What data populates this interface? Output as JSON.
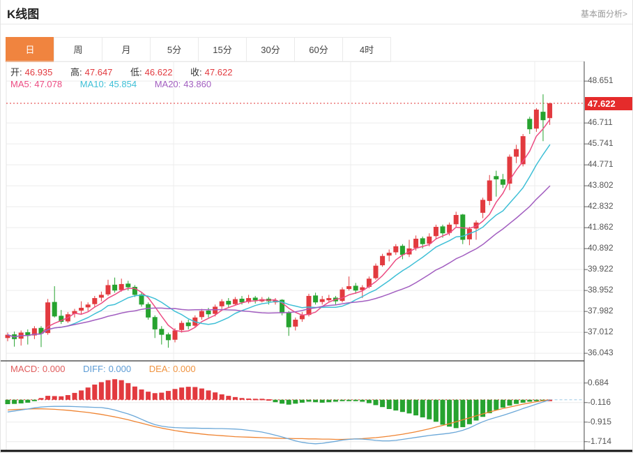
{
  "header": {
    "title": "K线图",
    "link": "基本面分析>"
  },
  "tabs": {
    "active_index": 0,
    "items": [
      "日",
      "周",
      "月",
      "5分",
      "15分",
      "30分",
      "60分",
      "4时"
    ]
  },
  "quote": {
    "open_label": "开:",
    "open": "46.935",
    "high_label": "高:",
    "high": "47.647",
    "low_label": "低:",
    "low": "46.622",
    "close_label": "收:",
    "close": "47.622"
  },
  "ma": {
    "ma5_label": "MA5:",
    "ma5": "47.078",
    "ma10_label": "MA10:",
    "ma10": "45.854",
    "ma20_label": "MA20:",
    "ma20": "43.860"
  },
  "macd_header": {
    "macd_label": "MACD:",
    "macd": "0.000",
    "diff_label": "DIFF:",
    "diff": "0.000",
    "dea_label": "DEA:",
    "dea": "0.000"
  },
  "price_tag": "47.622",
  "colors": {
    "up": "#e23a3f",
    "down": "#26a32f",
    "ma5": "#ec4b82",
    "ma10": "#3ebfd6",
    "ma20": "#a25ec0",
    "diff_line": "#6aa7d8",
    "dea_line": "#ef8432",
    "tab_active": "#f0843f",
    "tag_bg": "#e52b2b",
    "grid": "#ececec",
    "axis": "#555",
    "dotted_price": "#e03030"
  },
  "chart_data": {
    "type": "candlestick+macd",
    "title": "K线图",
    "legend": [
      "MA5",
      "MA10",
      "MA20",
      "MACD",
      "DIFF",
      "DEA"
    ],
    "price_axis_ticks": [
      "48.651",
      "46.711",
      "45.741",
      "44.771",
      "43.802",
      "42.832",
      "41.862",
      "40.892",
      "39.922",
      "38.952",
      "37.982",
      "37.012",
      "36.043"
    ],
    "macd_axis_ticks": [
      "0.684",
      "-0.116",
      "-0.915",
      "-1.714"
    ],
    "current_price": 47.622,
    "ma_periods": [
      5,
      10,
      20
    ],
    "ma_values_shown": {
      "ma5": 47.078,
      "ma10": 45.854,
      "ma20": 43.86
    },
    "candles": [
      [
        36.75,
        37.0,
        36.6,
        36.9
      ],
      [
        36.92,
        37.05,
        36.35,
        36.7
      ],
      [
        36.72,
        37.1,
        36.4,
        37.0
      ],
      [
        37.02,
        37.15,
        36.45,
        36.85
      ],
      [
        36.87,
        37.3,
        36.7,
        37.2
      ],
      [
        37.22,
        37.3,
        36.33,
        36.95
      ],
      [
        36.98,
        38.56,
        36.9,
        38.4
      ],
      [
        38.42,
        39.15,
        37.7,
        37.75
      ],
      [
        37.78,
        38.05,
        37.4,
        37.5
      ],
      [
        37.52,
        37.95,
        37.45,
        37.85
      ],
      [
        37.87,
        38.1,
        37.7,
        38.0
      ],
      [
        38.02,
        38.45,
        37.85,
        38.15
      ],
      [
        38.17,
        38.4,
        38.0,
        38.3
      ],
      [
        38.32,
        38.7,
        38.2,
        38.6
      ],
      [
        38.62,
        38.9,
        38.45,
        38.75
      ],
      [
        38.77,
        39.45,
        38.7,
        39.2
      ],
      [
        39.22,
        39.55,
        38.85,
        38.95
      ],
      [
        38.97,
        39.5,
        38.9,
        39.25
      ],
      [
        39.27,
        39.4,
        38.95,
        39.1
      ],
      [
        39.12,
        39.2,
        38.65,
        38.75
      ],
      [
        38.77,
        38.85,
        38.2,
        38.3
      ],
      [
        38.32,
        38.4,
        37.6,
        37.7
      ],
      [
        37.72,
        37.8,
        36.75,
        37.15
      ],
      [
        37.17,
        37.3,
        36.45,
        36.9
      ],
      [
        36.92,
        37.0,
        36.3,
        36.65
      ],
      [
        36.67,
        37.2,
        36.55,
        37.1
      ],
      [
        37.12,
        37.55,
        37.0,
        37.45
      ],
      [
        37.47,
        37.6,
        37.15,
        37.3
      ],
      [
        37.32,
        37.8,
        37.25,
        37.7
      ],
      [
        37.72,
        38.1,
        37.6,
        38.0
      ],
      [
        38.02,
        38.15,
        37.7,
        37.85
      ],
      [
        37.87,
        38.3,
        37.75,
        38.2
      ],
      [
        38.22,
        38.55,
        38.1,
        38.45
      ],
      [
        38.47,
        38.6,
        38.15,
        38.3
      ],
      [
        38.32,
        38.65,
        38.25,
        38.55
      ],
      [
        38.57,
        38.7,
        38.3,
        38.4
      ],
      [
        38.42,
        38.75,
        38.35,
        38.6
      ],
      [
        38.62,
        38.7,
        38.35,
        38.5
      ],
      [
        38.45,
        38.65,
        38.4,
        38.55
      ],
      [
        38.57,
        38.65,
        38.3,
        38.45
      ],
      [
        38.4,
        38.6,
        38.3,
        38.5
      ],
      [
        38.52,
        38.55,
        37.8,
        37.9
      ],
      [
        37.92,
        38.0,
        36.85,
        37.25
      ],
      [
        37.28,
        37.7,
        37.1,
        37.6
      ],
      [
        37.62,
        37.95,
        37.5,
        37.8
      ],
      [
        37.82,
        38.8,
        37.75,
        38.7
      ],
      [
        38.72,
        38.85,
        38.3,
        38.4
      ],
      [
        38.42,
        38.7,
        38.3,
        38.55
      ],
      [
        38.5,
        38.75,
        38.4,
        38.6
      ],
      [
        38.62,
        38.7,
        38.3,
        38.45
      ],
      [
        38.47,
        39.1,
        38.4,
        39.0
      ],
      [
        39.02,
        39.6,
        38.95,
        39.15
      ],
      [
        39.17,
        39.3,
        38.8,
        38.95
      ],
      [
        38.97,
        39.2,
        38.6,
        39.1
      ],
      [
        39.12,
        39.6,
        39.05,
        39.5
      ],
      [
        39.52,
        40.2,
        39.45,
        40.1
      ],
      [
        40.12,
        40.65,
        40.05,
        40.55
      ],
      [
        40.57,
        40.85,
        40.3,
        40.7
      ],
      [
        40.72,
        41.1,
        40.6,
        41.0
      ],
      [
        41.02,
        41.1,
        40.4,
        40.6
      ],
      [
        40.62,
        41.3,
        40.5,
        40.9
      ],
      [
        40.92,
        41.5,
        40.8,
        41.35
      ],
      [
        41.37,
        41.45,
        40.9,
        41.1
      ],
      [
        41.12,
        41.6,
        41.0,
        41.45
      ],
      [
        41.47,
        42.0,
        41.35,
        41.9
      ],
      [
        41.92,
        42.0,
        41.4,
        41.6
      ],
      [
        41.62,
        42.1,
        41.5,
        42.0
      ],
      [
        42.02,
        42.6,
        41.9,
        42.45
      ],
      [
        42.47,
        42.5,
        41.1,
        41.3
      ],
      [
        41.32,
        41.9,
        41.05,
        41.8
      ],
      [
        41.82,
        42.2,
        41.3,
        42.1
      ],
      [
        42.55,
        43.25,
        42.3,
        43.15
      ],
      [
        43.1,
        44.3,
        42.9,
        44.05
      ],
      [
        44.25,
        44.5,
        43.3,
        44.1
      ],
      [
        44.1,
        44.35,
        43.7,
        43.85
      ],
      [
        43.9,
        45.25,
        43.6,
        45.15
      ],
      [
        45.15,
        45.7,
        44.85,
        45.5
      ],
      [
        44.8,
        46.2,
        44.7,
        46.1
      ],
      [
        46.9,
        47.0,
        46.2,
        46.42
      ],
      [
        46.45,
        47.4,
        46.3,
        47.33
      ],
      [
        47.23,
        48.04,
        45.87,
        46.84
      ],
      [
        46.935,
        47.647,
        46.622,
        47.622
      ]
    ],
    "macd_hist": [
      -0.18,
      -0.17,
      -0.15,
      -0.12,
      -0.04,
      0.07,
      0.16,
      0.15,
      0.14,
      0.19,
      0.28,
      0.38,
      0.5,
      0.62,
      0.72,
      0.8,
      0.84,
      0.8,
      0.68,
      0.54,
      0.42,
      0.33,
      0.27,
      0.29,
      0.36,
      0.44,
      0.5,
      0.53,
      0.52,
      0.46,
      0.38,
      0.3,
      0.22,
      0.16,
      0.11,
      0.07,
      0.05,
      0.04,
      0.04,
      0.02,
      -0.1,
      -0.16,
      -0.2,
      -0.16,
      -0.12,
      -0.08,
      -0.1,
      -0.12,
      -0.1,
      -0.08,
      -0.05,
      -0.03,
      -0.02,
      -0.08,
      -0.14,
      -0.22,
      -0.3,
      -0.38,
      -0.44,
      -0.5,
      -0.56,
      -0.64,
      -0.72,
      -0.8,
      -0.9,
      -1.02,
      -1.1,
      -1.16,
      -1.12,
      -1.0,
      -0.85,
      -0.7,
      -0.55,
      -0.42,
      -0.32,
      -0.24,
      -0.17,
      -0.12,
      -0.08,
      -0.05,
      -0.02,
      0.0
    ],
    "macd_diff": [
      -0.5,
      -0.46,
      -0.42,
      -0.38,
      -0.33,
      -0.3,
      -0.28,
      -0.27,
      -0.27,
      -0.27,
      -0.28,
      -0.29,
      -0.3,
      -0.31,
      -0.32,
      -0.36,
      -0.42,
      -0.5,
      -0.58,
      -0.68,
      -0.8,
      -0.92,
      -1.02,
      -1.08,
      -1.12,
      -1.14,
      -1.15,
      -1.16,
      -1.16,
      -1.17,
      -1.17,
      -1.18,
      -1.18,
      -1.19,
      -1.2,
      -1.22,
      -1.25,
      -1.28,
      -1.32,
      -1.38,
      -1.45,
      -1.52,
      -1.6,
      -1.68,
      -1.74,
      -1.78,
      -1.8,
      -1.78,
      -1.74,
      -1.7,
      -1.65,
      -1.62,
      -1.6,
      -1.61,
      -1.63,
      -1.66,
      -1.68,
      -1.68,
      -1.66,
      -1.62,
      -1.58,
      -1.54,
      -1.5,
      -1.46,
      -1.43,
      -1.4,
      -1.37,
      -1.32,
      -1.25,
      -1.15,
      -1.02,
      -0.9,
      -0.8,
      -0.72,
      -0.64,
      -0.55,
      -0.46,
      -0.36,
      -0.27,
      -0.18,
      -0.09,
      0.0
    ],
    "macd_dea": [
      -0.42,
      -0.4,
      -0.39,
      -0.38,
      -0.37,
      -0.37,
      -0.38,
      -0.39,
      -0.41,
      -0.43,
      -0.46,
      -0.49,
      -0.52,
      -0.56,
      -0.6,
      -0.65,
      -0.7,
      -0.76,
      -0.82,
      -0.89,
      -0.96,
      -1.03,
      -1.1,
      -1.16,
      -1.21,
      -1.26,
      -1.3,
      -1.34,
      -1.37,
      -1.4,
      -1.43,
      -1.45,
      -1.47,
      -1.49,
      -1.51,
      -1.52,
      -1.53,
      -1.54,
      -1.55,
      -1.56,
      -1.57,
      -1.58,
      -1.58,
      -1.59,
      -1.59,
      -1.6,
      -1.6,
      -1.61,
      -1.61,
      -1.62,
      -1.62,
      -1.61,
      -1.6,
      -1.59,
      -1.57,
      -1.55,
      -1.52,
      -1.49,
      -1.45,
      -1.41,
      -1.36,
      -1.31,
      -1.25,
      -1.19,
      -1.12,
      -1.05,
      -0.98,
      -0.9,
      -0.82,
      -0.74,
      -0.66,
      -0.58,
      -0.5,
      -0.43,
      -0.36,
      -0.3,
      -0.24,
      -0.18,
      -0.13,
      -0.08,
      -0.04,
      0.0
    ]
  }
}
